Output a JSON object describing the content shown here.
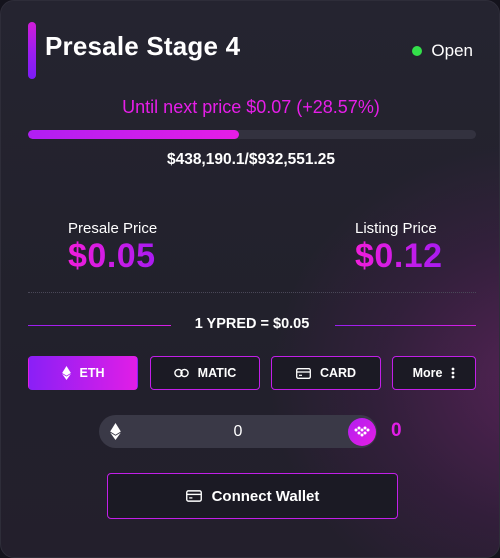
{
  "header": {
    "title": "Presale Stage 4",
    "status": "Open",
    "status_color": "#33e04a"
  },
  "progress": {
    "next_price_text": "Until next price $0.07 (+28.57%)",
    "raised_text": "$438,190.1/$932,551.25",
    "fraction": 0.47
  },
  "prices": {
    "presale_label": "Presale Price",
    "presale_value": "$0.05",
    "listing_label": "Listing Price",
    "listing_value": "$0.12"
  },
  "rate_text": "1 YPRED = $0.05",
  "payment_methods": [
    {
      "label": "ETH",
      "icon": "ethereum-icon",
      "active": true
    },
    {
      "label": "MATIC",
      "icon": "matic-icon",
      "active": false
    },
    {
      "label": "CARD",
      "icon": "credit-card-icon",
      "active": false
    },
    {
      "label": "More",
      "icon": "vertical-dots-icon",
      "active": false
    }
  ],
  "amount": {
    "pay_value": "0",
    "receive_value": "0",
    "pay_icon": "ethereum-icon",
    "receive_icon": "ypred-token-icon"
  },
  "connect_label": "Connect Wallet",
  "colors": {
    "accent_magenta": "#e61ee8",
    "accent_purple": "#8a1ff6",
    "background": "#22212c"
  }
}
